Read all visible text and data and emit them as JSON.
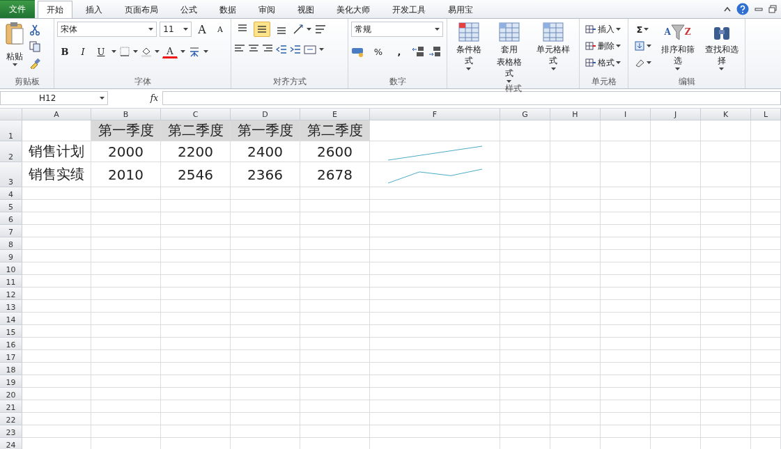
{
  "tabs": [
    {
      "label": "文件",
      "kind": "file",
      "selected": false
    },
    {
      "label": "开始",
      "kind": "tab",
      "selected": true
    },
    {
      "label": "插入",
      "kind": "tab",
      "selected": false
    },
    {
      "label": "页面布局",
      "kind": "tab",
      "selected": false
    },
    {
      "label": "公式",
      "kind": "tab",
      "selected": false
    },
    {
      "label": "数据",
      "kind": "tab",
      "selected": false
    },
    {
      "label": "审阅",
      "kind": "tab",
      "selected": false
    },
    {
      "label": "视图",
      "kind": "tab",
      "selected": false
    },
    {
      "label": "美化大师",
      "kind": "tab",
      "selected": false
    },
    {
      "label": "开发工具",
      "kind": "tab",
      "selected": false
    },
    {
      "label": "易用宝",
      "kind": "tab",
      "selected": false
    }
  ],
  "clipboard": {
    "paste": "粘贴",
    "label": "剪贴板"
  },
  "font": {
    "name": "宋体",
    "size": "11",
    "grow": "A",
    "shrink": "A",
    "bold": "B",
    "italic": "I",
    "underline": "U",
    "color_letter": "A",
    "label": "字体"
  },
  "alignment": {
    "label": "对齐方式",
    "vertical": [
      {
        "kind": "top",
        "on": false
      },
      {
        "kind": "middle",
        "on": true
      },
      {
        "kind": "bottom",
        "on": false
      }
    ]
  },
  "number": {
    "format": "常规",
    "percent": "%",
    "comma": ",",
    "label": "数字"
  },
  "styles": {
    "label": "样式",
    "buttons": [
      {
        "lines": [
          "条件格式"
        ]
      },
      {
        "lines": [
          "套用",
          "表格格式"
        ]
      },
      {
        "lines": [
          "单元格样式"
        ]
      }
    ]
  },
  "cells": {
    "label": "单元格",
    "buttons": [
      "插入",
      "删除",
      "格式"
    ]
  },
  "editing": {
    "label": "编辑",
    "sum": "Σ",
    "sort_letters": [
      "A",
      "Z"
    ],
    "buttons": [
      "排序和筛选",
      "查找和选择"
    ]
  },
  "formula_bar": {
    "name_box": "H12",
    "fx": "fx"
  },
  "sheet": {
    "columns": [
      "A",
      "B",
      "C",
      "D",
      "E",
      "F",
      "G",
      "H",
      "I",
      "J",
      "K",
      "L"
    ],
    "rows": [
      {
        "number": "1",
        "kind": "header",
        "cells": [
          null,
          "第一季度",
          "第二季度",
          "第一季度",
          "第二季度"
        ]
      },
      {
        "number": "2",
        "kind": "data",
        "sparkline": true,
        "cells": [
          "销售计划",
          "2000",
          "2200",
          "2400",
          "2600"
        ]
      },
      {
        "number": "3",
        "kind": "data",
        "sparkline": true,
        "cells": [
          "销售实绩",
          "2010",
          "2546",
          "2366",
          "2678"
        ]
      },
      {
        "number": "4"
      },
      {
        "number": "5"
      },
      {
        "number": "6"
      },
      {
        "number": "7"
      },
      {
        "number": "8"
      },
      {
        "number": "9"
      },
      {
        "number": "10"
      },
      {
        "number": "11"
      },
      {
        "number": "12"
      },
      {
        "number": "13"
      },
      {
        "number": "14"
      },
      {
        "number": "15"
      },
      {
        "number": "16"
      },
      {
        "number": "17"
      },
      {
        "number": "18"
      },
      {
        "number": "19"
      },
      {
        "number": "20"
      },
      {
        "number": "21"
      },
      {
        "number": "22"
      },
      {
        "number": "23"
      },
      {
        "number": "24"
      }
    ]
  }
}
